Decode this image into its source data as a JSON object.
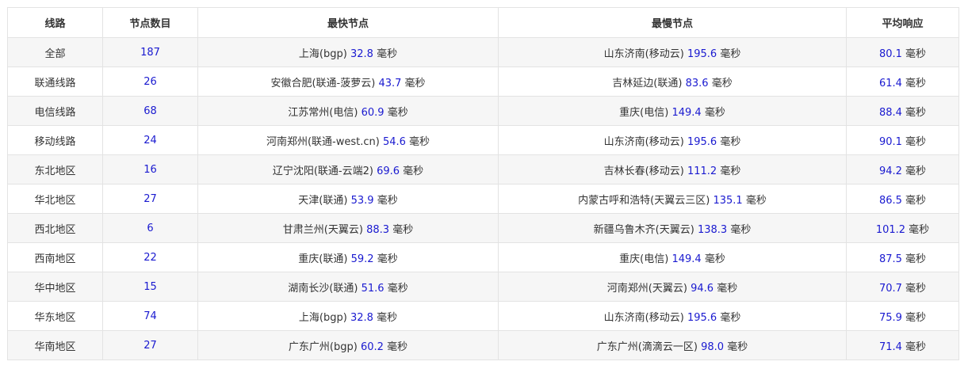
{
  "colors": {
    "value": "#1a1ad0",
    "text": "#333333",
    "border": "#e3e3e3",
    "row_alt": "#f6f6f6"
  },
  "headers": [
    "线路",
    "节点数目",
    "最快节点",
    "最慢节点",
    "平均响应"
  ],
  "unit": "毫秒",
  "rows": [
    {
      "line": "全部",
      "count": "187",
      "fast_name": "上海(bgp)",
      "fast_ms": "32.8",
      "slow_name": "山东济南(移动云)",
      "slow_ms": "195.6",
      "avg_ms": "80.1"
    },
    {
      "line": "联通线路",
      "count": "26",
      "fast_name": "安徽合肥(联通-菠萝云)",
      "fast_ms": "43.7",
      "slow_name": "吉林延边(联通)",
      "slow_ms": "83.6",
      "avg_ms": "61.4"
    },
    {
      "line": "电信线路",
      "count": "68",
      "fast_name": "江苏常州(电信)",
      "fast_ms": "60.9",
      "slow_name": "重庆(电信)",
      "slow_ms": "149.4",
      "avg_ms": "88.4"
    },
    {
      "line": "移动线路",
      "count": "24",
      "fast_name": "河南郑州(联通-west.cn)",
      "fast_ms": "54.6",
      "slow_name": "山东济南(移动云)",
      "slow_ms": "195.6",
      "avg_ms": "90.1"
    },
    {
      "line": "东北地区",
      "count": "16",
      "fast_name": "辽宁沈阳(联通-云端2)",
      "fast_ms": "69.6",
      "slow_name": "吉林长春(移动云)",
      "slow_ms": "111.2",
      "avg_ms": "94.2"
    },
    {
      "line": "华北地区",
      "count": "27",
      "fast_name": "天津(联通)",
      "fast_ms": "53.9",
      "slow_name": "内蒙古呼和浩特(天翼云三区)",
      "slow_ms": "135.1",
      "avg_ms": "86.5"
    },
    {
      "line": "西北地区",
      "count": "6",
      "fast_name": "甘肃兰州(天翼云)",
      "fast_ms": "88.3",
      "slow_name": "新疆乌鲁木齐(天翼云)",
      "slow_ms": "138.3",
      "avg_ms": "101.2"
    },
    {
      "line": "西南地区",
      "count": "22",
      "fast_name": "重庆(联通)",
      "fast_ms": "59.2",
      "slow_name": "重庆(电信)",
      "slow_ms": "149.4",
      "avg_ms": "87.5"
    },
    {
      "line": "华中地区",
      "count": "15",
      "fast_name": "湖南长沙(联通)",
      "fast_ms": "51.6",
      "slow_name": "河南郑州(天翼云)",
      "slow_ms": "94.6",
      "avg_ms": "70.7"
    },
    {
      "line": "华东地区",
      "count": "74",
      "fast_name": "上海(bgp)",
      "fast_ms": "32.8",
      "slow_name": "山东济南(移动云)",
      "slow_ms": "195.6",
      "avg_ms": "75.9"
    },
    {
      "line": "华南地区",
      "count": "27",
      "fast_name": "广东广州(bgp)",
      "fast_ms": "60.2",
      "slow_name": "广东广州(滴滴云一区)",
      "slow_ms": "98.0",
      "avg_ms": "71.4"
    }
  ]
}
